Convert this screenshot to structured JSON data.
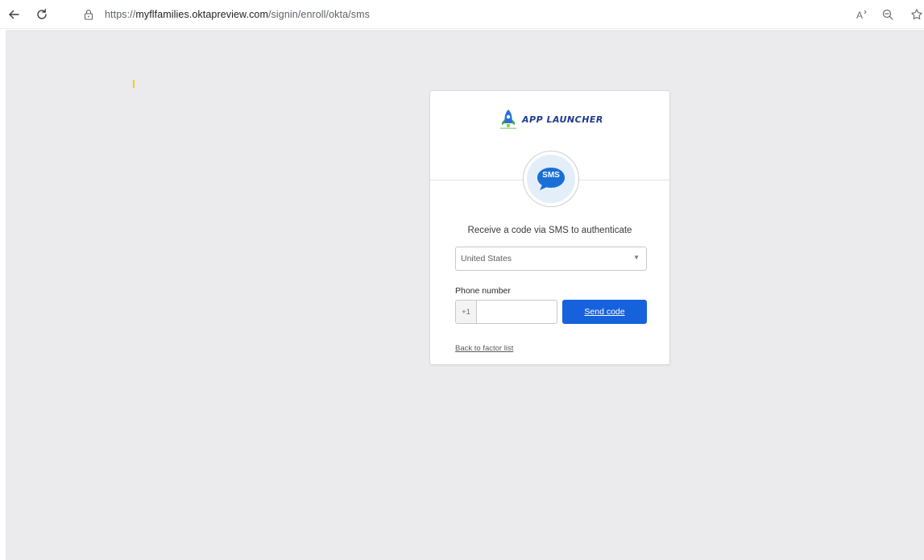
{
  "browser": {
    "url_prefix": "https://",
    "url_domain": "myflfamilies.oktapreview.com",
    "url_path": "/signin/enroll/okta/sms",
    "icons": [
      "back-icon",
      "reload-icon",
      "lock-icon",
      "read-aloud-icon",
      "zoom-icon",
      "favorite-star-icon"
    ]
  },
  "logo": {
    "text": "APP LAUNCHER"
  },
  "sms_icon": {
    "label": "SMS",
    "color": "#1a6fd6"
  },
  "form": {
    "subtitle": "Receive a code via SMS to authenticate",
    "country": "United States",
    "phone_label": "Phone number",
    "phone_prefix": "+1",
    "phone_value": "",
    "send_label": "Send code",
    "back_link": "Back to factor list"
  },
  "colors": {
    "accent": "#1662dd",
    "page_bg": "#ebebed"
  }
}
